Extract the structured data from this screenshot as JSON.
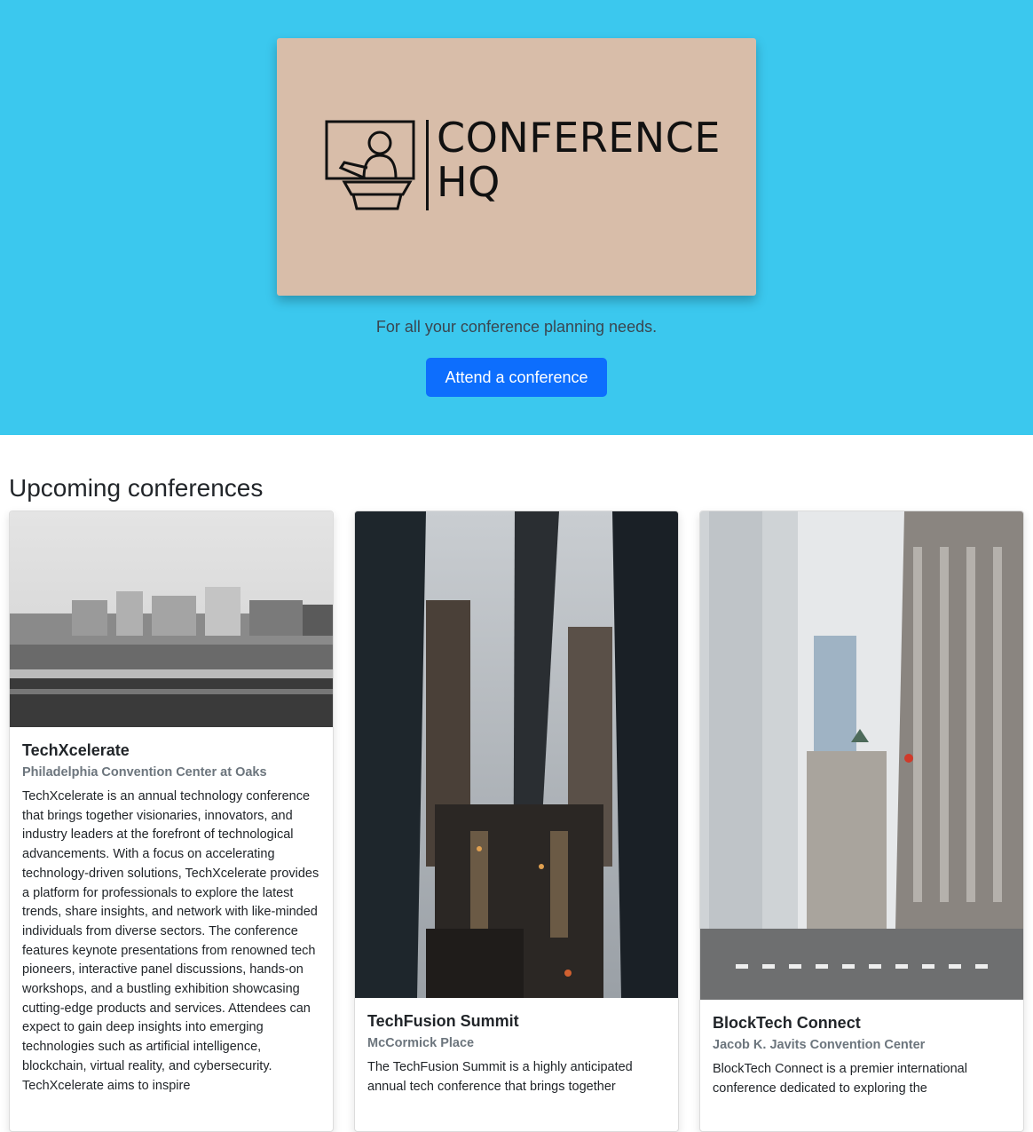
{
  "hero": {
    "logo_line1": "CONFERENCE",
    "logo_line2": "HQ",
    "tagline": "For all your conference planning needs.",
    "cta_label": "Attend a conference",
    "background": "#3bc8ee",
    "logo_background": "#d8bda9",
    "cta_color": "#0d6efd"
  },
  "section_title": "Upcoming conferences",
  "conferences": [
    {
      "name": "TechXcelerate",
      "venue": "Philadelphia Convention Center at Oaks",
      "description": "TechXcelerate is an annual technology conference that brings together visionaries, innovators, and industry leaders at the forefront of technological advancements. With a focus on accelerating technology-driven solutions, TechXcelerate provides a platform for professionals to explore the latest trends, share insights, and network with like-minded individuals from diverse sectors. The conference features keynote presentations from renowned tech pioneers, interactive panel discussions, hands-on workshops, and a bustling exhibition showcasing cutting-edge products and services. Attendees can expect to gain deep insights into emerging technologies such as artificial intelligence, blockchain, virtual reality, and cybersecurity. TechXcelerate aims to inspire"
    },
    {
      "name": "TechFusion Summit",
      "venue": "McCormick Place",
      "description": "The TechFusion Summit is a highly anticipated annual tech conference that brings together"
    },
    {
      "name": "BlockTech Connect",
      "venue": "Jacob K. Javits Convention Center",
      "description": "BlockTech Connect is a premier international conference dedicated to exploring the"
    }
  ]
}
